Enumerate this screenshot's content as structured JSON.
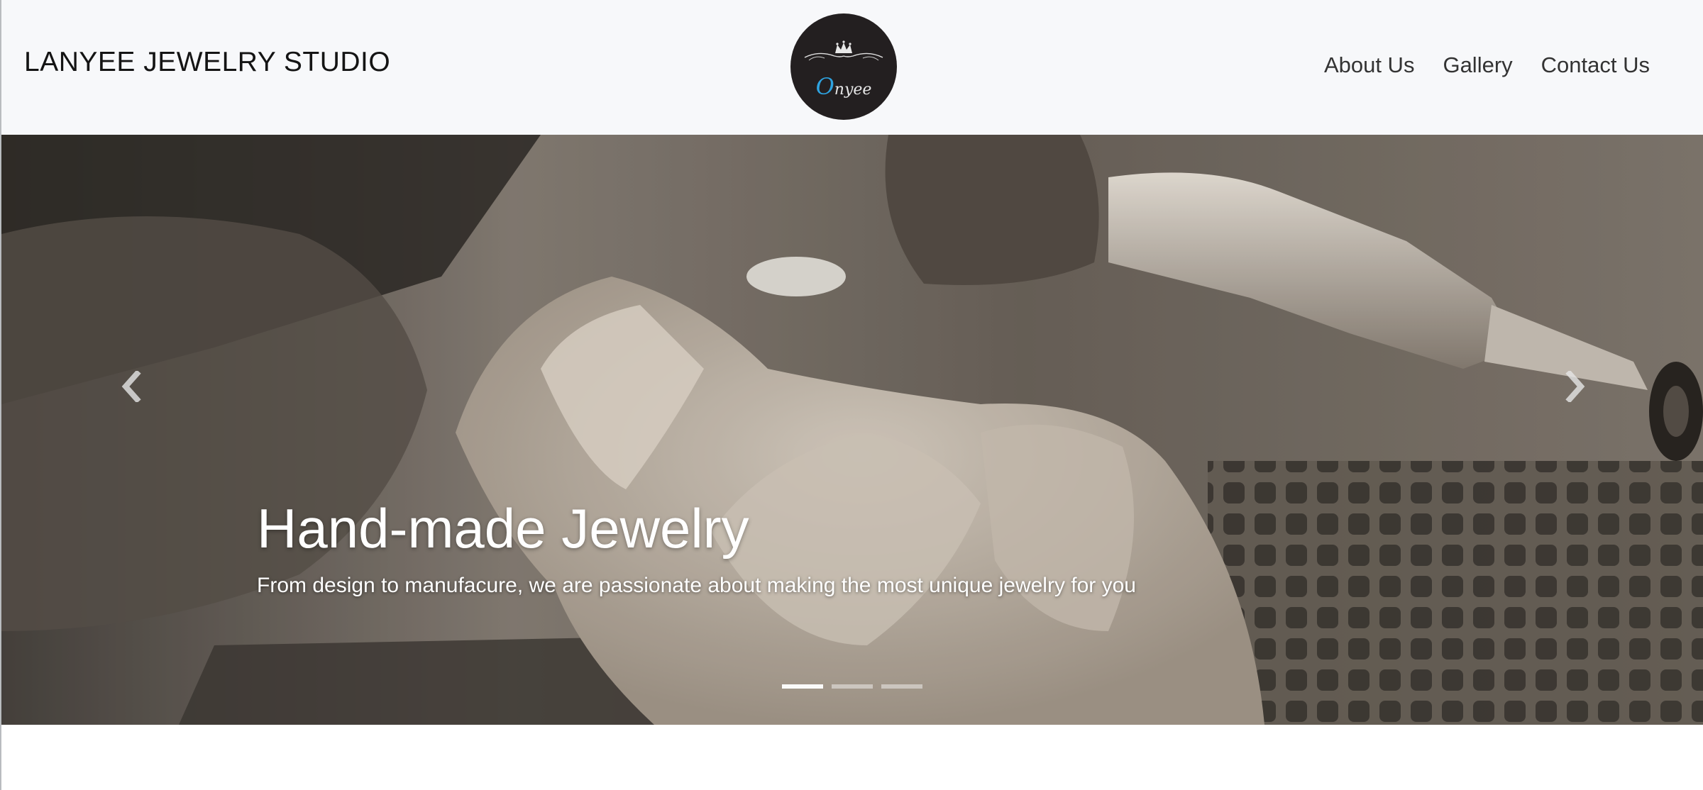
{
  "navbar": {
    "brand": "LANYEE JEWELRY STUDIO",
    "logo": {
      "text_initial": "O",
      "text_rest": "nyee"
    },
    "links": [
      {
        "label": "About Us"
      },
      {
        "label": "Gallery"
      },
      {
        "label": "Contact Us"
      }
    ]
  },
  "carousel": {
    "slides_count": 3,
    "active_index": 0,
    "caption": {
      "title": "Hand-made Jewelry",
      "text": "From design to manufacure, we are passionate about making the most unique jewelry for you"
    },
    "prev_icon": "chevron-left-icon",
    "next_icon": "chevron-right-icon"
  },
  "colors": {
    "navbar_bg": "#f7f8fa",
    "logo_bg": "#231f20",
    "logo_accent": "#2ea3e0",
    "brand_text": "#141414",
    "nav_text": "#333333"
  }
}
